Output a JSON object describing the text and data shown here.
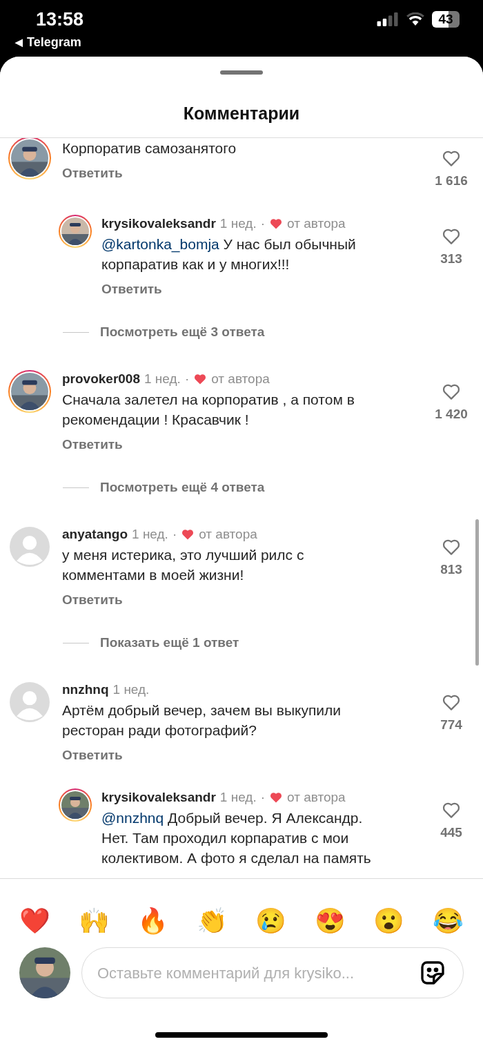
{
  "status_bar": {
    "time": "13:58",
    "back_arrow": "◀",
    "back_app": "Telegram",
    "battery": "43"
  },
  "title": "Комментарии",
  "comments": [
    {
      "kind": "comment",
      "avatar": {
        "kind": "picture"
      },
      "story_ring": true,
      "lines": [
        "Корпоратив самозанятого"
      ],
      "reply_label": "Ответить",
      "likes": "1 616"
    },
    {
      "kind": "reply",
      "avatar": {
        "kind": "picture"
      },
      "story_ring": true,
      "username": "krysikovaleksandr",
      "time": "1 нед.",
      "separator": "·",
      "liked_by_author": true,
      "author_label": "от автора",
      "mention": "@kartonka_bomja",
      "lines": [
        "У нас был обычный",
        "корпаратив как и у многих!!!"
      ],
      "reply_label": "Ответить",
      "likes": "313"
    },
    {
      "kind": "more",
      "label": "Посмотреть ещё 3 ответа"
    },
    {
      "kind": "comment",
      "avatar": {
        "kind": "picture"
      },
      "story_ring": true,
      "username": "provoker008",
      "time": "1 нед.",
      "separator": "·",
      "liked_by_author": true,
      "author_label": "от автора",
      "lines": [
        "Сначала залетел на корпоратив , а потом в",
        "рекомендации ! Красавчик !"
      ],
      "reply_label": "Ответить",
      "likes": "1 420"
    },
    {
      "kind": "more",
      "label": "Посмотреть ещё 4 ответа"
    },
    {
      "kind": "comment",
      "avatar": {
        "kind": "placeholder"
      },
      "story_ring": false,
      "username": "anyatango",
      "time": "1 нед.",
      "separator": "·",
      "liked_by_author": true,
      "author_label": "от автора",
      "lines": [
        "у меня истерика, это лучший рилс с",
        "комментами в моей жизни!"
      ],
      "reply_label": "Ответить",
      "likes": "813"
    },
    {
      "kind": "more",
      "label": "Показать ещё 1 ответ"
    },
    {
      "kind": "comment",
      "avatar": {
        "kind": "placeholder"
      },
      "story_ring": false,
      "username": "nnzhnq",
      "time": "1 нед.",
      "liked_by_author": false,
      "lines": [
        "Артём добрый вечер, зачем вы выкупили",
        "ресторан ради фотографий?"
      ],
      "reply_label": "Ответить",
      "likes": "774"
    },
    {
      "kind": "reply",
      "avatar": {
        "kind": "picture"
      },
      "story_ring": true,
      "username": "krysikovaleksandr",
      "time": "1 нед.",
      "separator": "·",
      "liked_by_author": true,
      "author_label": "от автора",
      "mention": "@nnzhnq",
      "lines": [
        "Добрый вечер. Я Александр.",
        "Нет. Там проходил корпаратив с мои",
        "колективом. А фото я сделал на память"
      ],
      "likes": "445"
    }
  ],
  "reactions": [
    "❤️",
    "🙌",
    "🔥",
    "👏",
    "😢",
    "😍",
    "😮",
    "😂"
  ],
  "input": {
    "placeholder": "Оставьте комментарий для krysiko..."
  }
}
